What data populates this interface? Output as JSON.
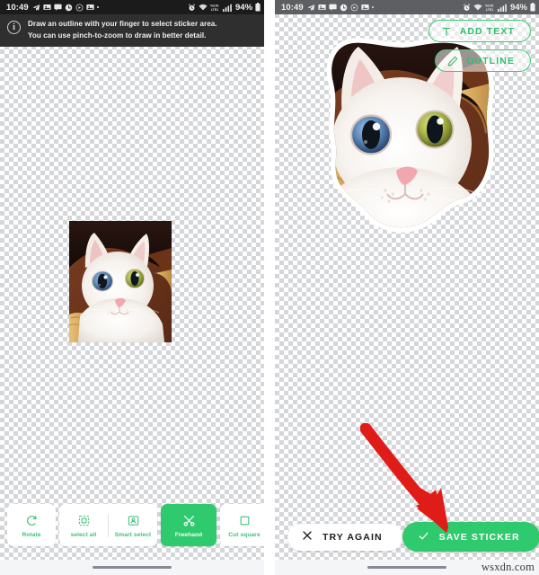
{
  "status_bar": {
    "time": "10:49",
    "left_icons": [
      "telegram-icon",
      "gallery-icon",
      "message-icon",
      "clock-icon",
      "record-icon",
      "gallery-icon",
      "dot-icon"
    ],
    "right_icons": [
      "alarm-icon",
      "wifi-icon",
      "volte-icon",
      "signal-icon"
    ],
    "battery_percent": "94%",
    "battery_icon": "battery-icon"
  },
  "left_panel": {
    "banner": {
      "icon": "info-icon",
      "line1": "Draw an outline with your finger to select sticker area.",
      "line2": "You can use pinch-to-zoom to draw in better detail."
    },
    "photo": {
      "alt": "white cat with heterochromia in a wicker basket"
    },
    "toolbar": {
      "items": [
        {
          "id": "rotate",
          "label": "Rotate",
          "icon": "rotate-icon",
          "active": false
        },
        {
          "id": "select-all",
          "label": "select all",
          "icon": "select-all-icon",
          "active": false
        },
        {
          "id": "smart-select",
          "label": "Smart select",
          "icon": "smart-select-icon",
          "active": false
        },
        {
          "id": "freehand",
          "label": "Freehand",
          "icon": "scissors-icon",
          "active": true
        },
        {
          "id": "cut-square",
          "label": "Cut square",
          "icon": "square-icon",
          "active": false
        }
      ]
    }
  },
  "right_panel": {
    "top_actions": [
      {
        "id": "add-text",
        "label": "ADD TEXT",
        "icon": "text-icon"
      },
      {
        "id": "outline",
        "label": "OUTLINE",
        "icon": "pencil-icon"
      }
    ],
    "sticker": {
      "alt": "cut-out sticker of white cat with heterochromia, white outline"
    },
    "bottom_actions": [
      {
        "id": "try-again",
        "label": "TRY AGAIN",
        "icon": "close-icon",
        "style": "secondary"
      },
      {
        "id": "save-sticker",
        "label": "SAVE STICKER",
        "icon": "check-icon",
        "style": "primary"
      }
    ],
    "annotation": {
      "type": "red-arrow",
      "points_to": "save-sticker"
    }
  },
  "watermark": "wsxdn.com",
  "colors": {
    "accent_green": "#2fca6e",
    "outline_green": "#3ecb78",
    "banner_bg": "#2f2f2f",
    "statusbar_dark": "#1b1b1b",
    "statusbar_light": "#5e5f62",
    "annotation_red": "#e01c18",
    "navbar_bg": "#f4f5f7"
  }
}
